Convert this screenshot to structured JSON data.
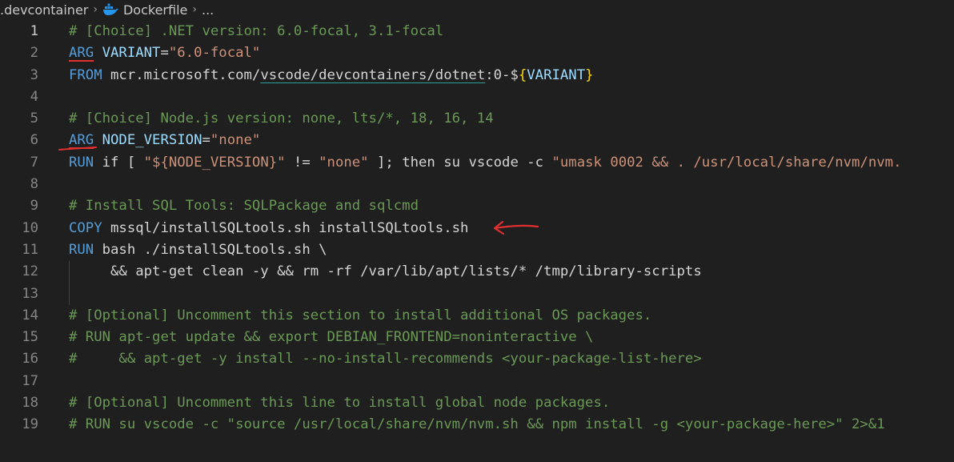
{
  "breadcrumb": {
    "folder": ".devcontainer",
    "file_icon": "docker-whale-icon",
    "file": "Dockerfile",
    "more": "..."
  },
  "annotation_color": "#e03030",
  "lines": [
    {
      "n": "1",
      "tokens": [
        {
          "t": "# [Choice] .NET version: 6.0-focal, 3.1-focal",
          "c": "cmt"
        }
      ]
    },
    {
      "n": "2",
      "tokens": [
        {
          "t": "ARG",
          "c": "kw ul-red"
        },
        {
          "t": " ",
          "c": "plain"
        },
        {
          "t": "VARIANT",
          "c": "var"
        },
        {
          "t": "=",
          "c": "plain"
        },
        {
          "t": "\"6.0-focal\"",
          "c": "str"
        }
      ]
    },
    {
      "n": "3",
      "tokens": [
        {
          "t": "FROM",
          "c": "kw"
        },
        {
          "t": " mcr.microsoft.com/",
          "c": "plain"
        },
        {
          "t": "vscode/devcontainers/dotnet",
          "c": "plain ul-link"
        },
        {
          "t": ":0-$",
          "c": "plain"
        },
        {
          "t": "{",
          "c": "bracket"
        },
        {
          "t": "VARIANT",
          "c": "var"
        },
        {
          "t": "}",
          "c": "bracket"
        }
      ]
    },
    {
      "n": "4",
      "tokens": []
    },
    {
      "n": "5",
      "tokens": [
        {
          "t": "# [Choice] Node.js version: none, lts/*, 18, 16, 14",
          "c": "cmt"
        }
      ]
    },
    {
      "n": "6",
      "tokens": [
        {
          "t": "ARG",
          "c": "kw ul-red"
        },
        {
          "t": " ",
          "c": "plain"
        },
        {
          "t": "NODE_VERSION",
          "c": "var"
        },
        {
          "t": "=",
          "c": "plain"
        },
        {
          "t": "\"none\"",
          "c": "str"
        }
      ]
    },
    {
      "n": "7",
      "tokens": [
        {
          "t": "RUN",
          "c": "kw"
        },
        {
          "t": " if [ ",
          "c": "plain"
        },
        {
          "t": "\"${NODE_VERSION}\"",
          "c": "str"
        },
        {
          "t": " != ",
          "c": "plain"
        },
        {
          "t": "\"none\"",
          "c": "str"
        },
        {
          "t": " ]; then su vscode -c ",
          "c": "plain"
        },
        {
          "t": "\"umask 0002 && . /usr/local/share/nvm/nvm.",
          "c": "str"
        }
      ]
    },
    {
      "n": "8",
      "tokens": []
    },
    {
      "n": "9",
      "tokens": [
        {
          "t": "# Install SQL Tools: SQLPackage and sqlcmd",
          "c": "cmt"
        }
      ]
    },
    {
      "n": "10",
      "tokens": [
        {
          "t": "COPY",
          "c": "kw"
        },
        {
          "t": " mssql/installSQLtools.sh installSQLtools.sh",
          "c": "plain"
        }
      ]
    },
    {
      "n": "11",
      "tokens": [
        {
          "t": "RUN",
          "c": "kw"
        },
        {
          "t": " bash ./installSQLtools.sh \\",
          "c": "plain"
        }
      ]
    },
    {
      "n": "12",
      "tokens": [
        {
          "t": "     && apt-get clean -y && rm -rf /var/lib/apt/lists/* /tmp/library-scripts",
          "c": "plain"
        }
      ]
    },
    {
      "n": "13",
      "tokens": []
    },
    {
      "n": "14",
      "tokens": [
        {
          "t": "# [Optional] Uncomment this section to install additional OS packages.",
          "c": "cmt"
        }
      ]
    },
    {
      "n": "15",
      "tokens": [
        {
          "t": "# RUN apt-get update && export DEBIAN_FRONTEND=noninteractive \\",
          "c": "cmt"
        }
      ]
    },
    {
      "n": "16",
      "tokens": [
        {
          "t": "#     && apt-get -y install --no-install-recommends <your-package-list-here>",
          "c": "cmt"
        }
      ]
    },
    {
      "n": "17",
      "tokens": []
    },
    {
      "n": "18",
      "tokens": [
        {
          "t": "# [Optional] Uncomment this line to install global node packages.",
          "c": "cmt"
        }
      ]
    },
    {
      "n": "19",
      "tokens": [
        {
          "t": "# RUN su vscode -c \"source /usr/local/share/nvm/nvm.sh && npm install -g <your-package-here>\" 2>&1",
          "c": "cmt"
        }
      ]
    }
  ]
}
